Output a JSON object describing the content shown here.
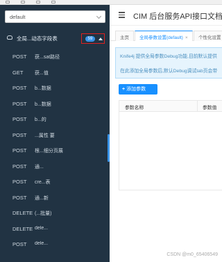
{
  "sidebar": {
    "select_value": "default",
    "group": {
      "title": "全局...动态字段表",
      "count": "59"
    },
    "endpoints": [
      {
        "method": "POST",
        "path": "获...sat路径"
      },
      {
        "method": "GET",
        "path": "获...值"
      },
      {
        "method": "POST",
        "path": "b...数据"
      },
      {
        "method": "POST",
        "path": "b...数据"
      },
      {
        "method": "POST",
        "path": "b...的"
      },
      {
        "method": "POST",
        "path": "...属性 要"
      },
      {
        "method": "POST",
        "path": "根...细分页展"
      },
      {
        "method": "POST",
        "path": "通..."
      },
      {
        "method": "POST",
        "path": "cre...表"
      },
      {
        "method": "POST",
        "path": "通...新"
      },
      {
        "method": "DELETE",
        "path": "(...批量)"
      },
      {
        "method": "DELETE",
        "path": "dele..."
      },
      {
        "method": "POST",
        "path": "dele..."
      }
    ]
  },
  "header": {
    "title": "CIM 后台服务API接口文档"
  },
  "tabs": [
    {
      "label": "主页"
    },
    {
      "label": "全局参数设置(default)",
      "close": "×"
    },
    {
      "label": "个性化设置"
    }
  ],
  "info": {
    "line1": "Knife4j 提供全局参数Debug功能,目前默认提供",
    "line2": "在此添加全局参数后,默认Debug调试tab页会带"
  },
  "add_button": {
    "icon": "+",
    "label": "添加参数"
  },
  "table": {
    "col1": "参数名称",
    "col2": "参数值"
  },
  "watermark": "CSDN @m0_65406549"
}
